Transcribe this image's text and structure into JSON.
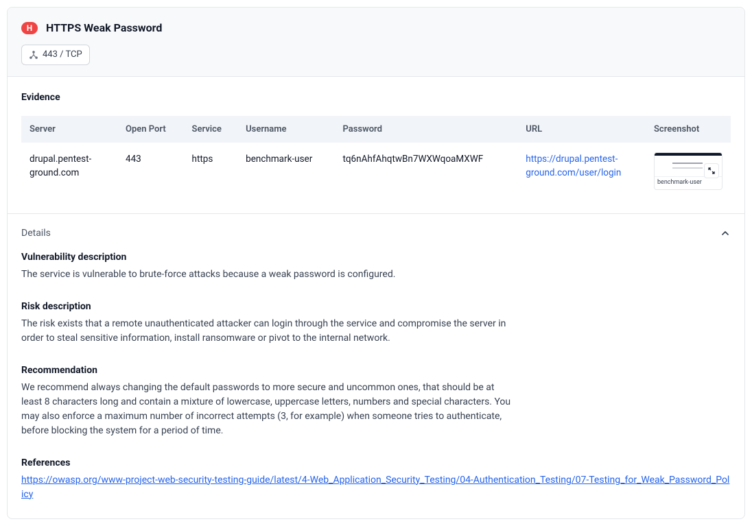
{
  "header": {
    "severity_letter": "H",
    "title": "HTTPS Weak Password",
    "port_chip": "443 / TCP"
  },
  "evidence": {
    "heading": "Evidence",
    "columns": {
      "server": "Server",
      "open_port": "Open Port",
      "service": "Service",
      "username": "Username",
      "password": "Password",
      "url": "URL",
      "screenshot": "Screenshot"
    },
    "row": {
      "server": "drupal.pentest-ground.com",
      "open_port": "443",
      "service": "https",
      "username": "benchmark-user",
      "password": "tq6nAhfAhqtwBn7WXWqoaMXWF",
      "url": "https://drupal.pentest-ground.com/user/login",
      "thumb_caption": "benchmark-user"
    }
  },
  "details": {
    "label": "Details",
    "vulnerability_heading": "Vulnerability description",
    "vulnerability_text": "The service is vulnerable to brute-force attacks because a weak password is configured.",
    "risk_heading": "Risk description",
    "risk_text": "The risk exists that a remote unauthenticated attacker can login through the service and compromise the server in order to steal sensitive information, install ransomware or pivot to the internal network.",
    "recommendation_heading": "Recommendation",
    "recommendation_text": "We recommend always changing the default passwords to more secure and uncommon ones, that should be at least 8 characters long and contain a mixture of lowercase, uppercase letters, numbers and special characters. You may also enforce a maximum number of incorrect attempts (3, for example) when someone tries to authenticate, before blocking the system for a period of time.",
    "references_heading": "References",
    "references_link": "https://owasp.org/www-project-web-security-testing-guide/latest/4-Web_Application_Security_Testing/04-Authentication_Testing/07-Testing_for_Weak_Password_Policy"
  }
}
